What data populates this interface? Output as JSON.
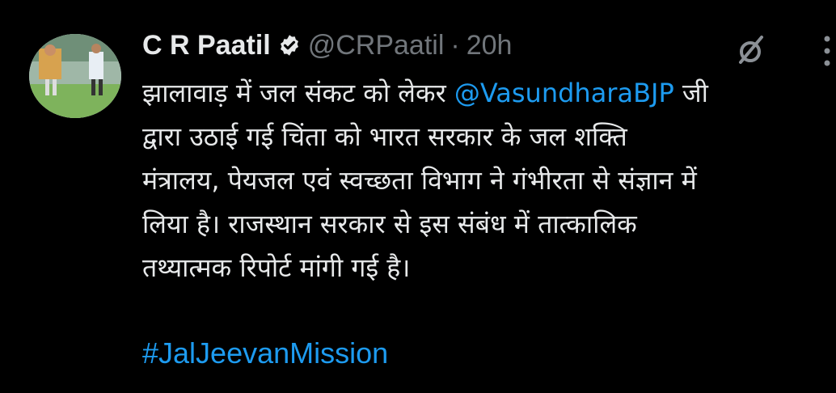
{
  "author": {
    "display_name": "C R Paatil",
    "handle": "@CRPaatil",
    "separator": "·",
    "time": "20h",
    "verified_icon": "verified-badge-icon"
  },
  "tweet": {
    "text_before_mention": "झालावाड़ में जल संकट को लेकर ",
    "mention": "@VasundharaBJP",
    "text_after_mention": " जी\nद्वारा उठाई गई चिंता को भारत सरकार के जल शक्ति\nमंत्रालय, पेयजल एवं स्वच्छता विभाग ने गंभीरता से संज्ञान में\nलिया है। राजस्थान सरकार से इस संबंध में तात्कालिक\nतथ्यात्मक रिपोर्ट मांगी गई है।",
    "hashtag": "#JalJeevanMission"
  },
  "icons": {
    "grok": "grok-icon",
    "more": "more-options-icon"
  },
  "colors": {
    "background": "#000000",
    "text": "#e7e9ea",
    "secondary": "#71767b",
    "link": "#1d9bf0"
  }
}
